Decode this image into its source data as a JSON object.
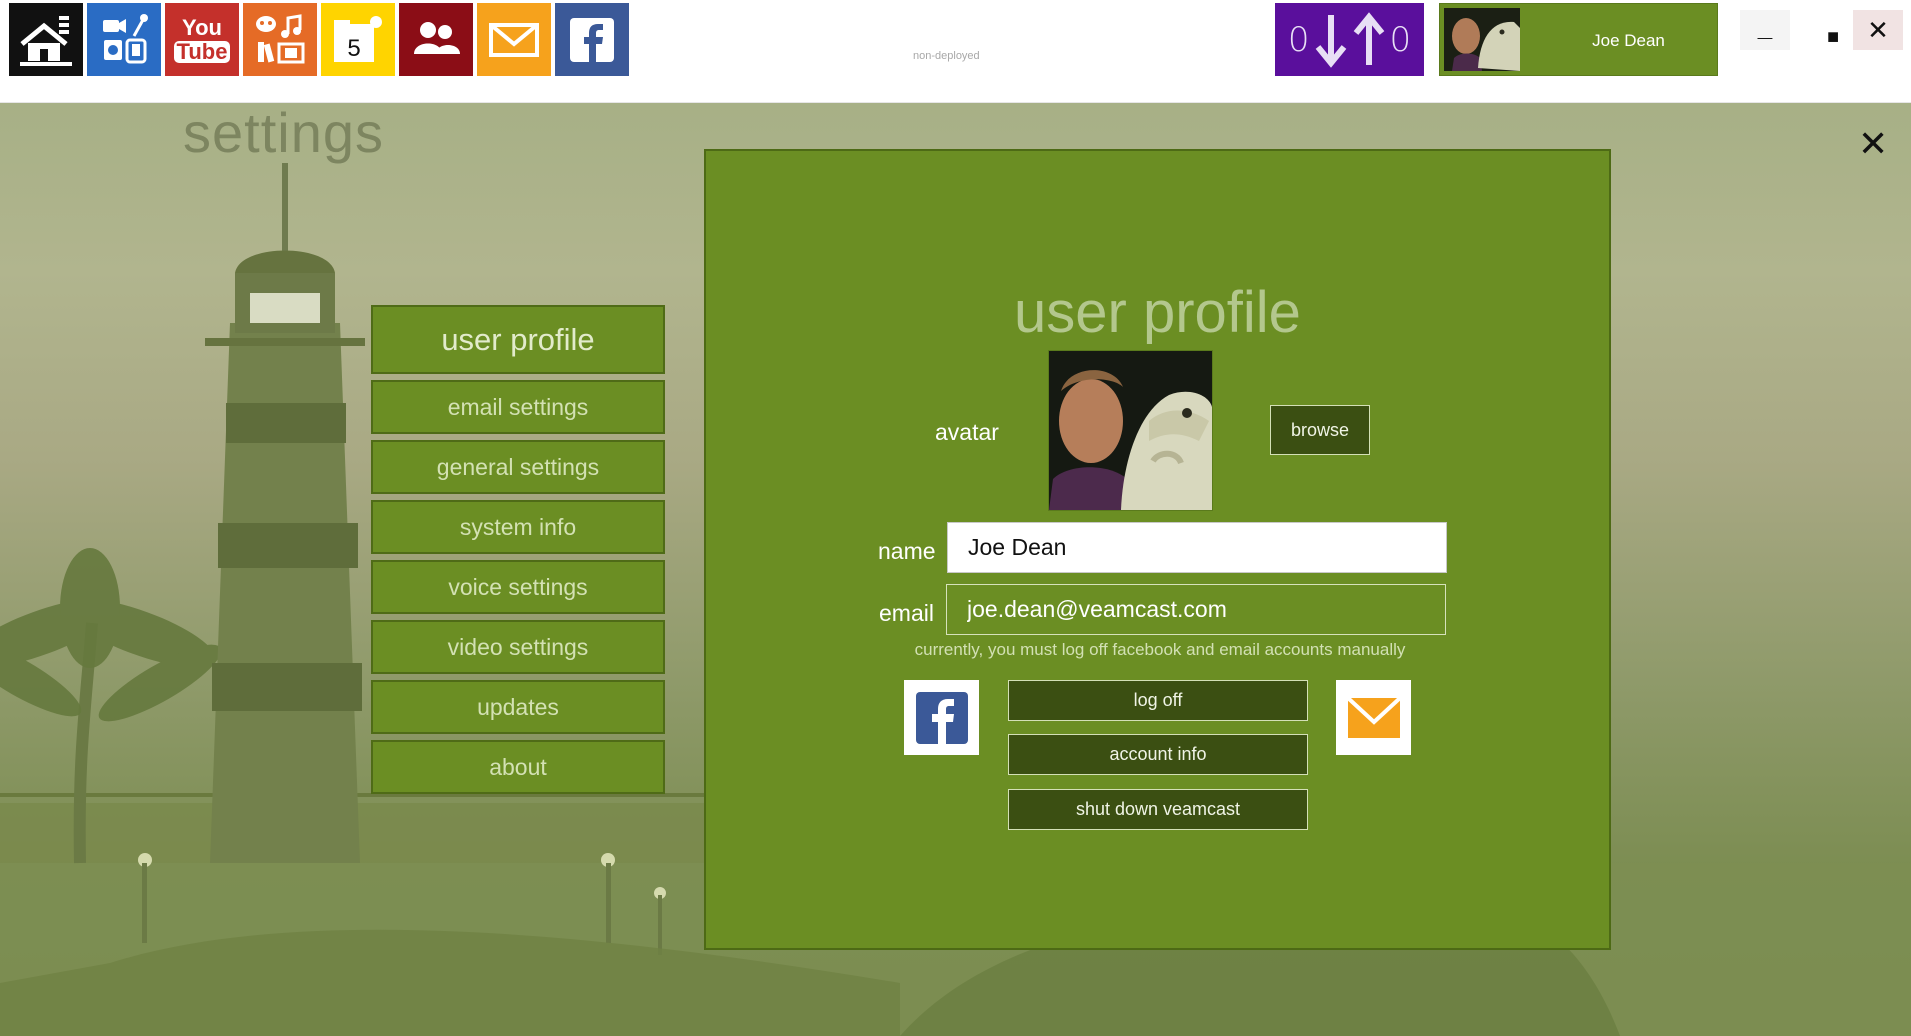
{
  "topbar": {
    "tiles": [
      {
        "icon": "home-icon",
        "color": "#111111"
      },
      {
        "icon": "media-devices-icon",
        "color": "#2a6cc4"
      },
      {
        "icon": "youtube-icon",
        "color": "#c4302b",
        "text_line1": "You",
        "text_line2": "Tube"
      },
      {
        "icon": "entertainment-icon",
        "color": "#e56b26"
      },
      {
        "icon": "calendar-icon",
        "color": "#ffd400",
        "day": "5"
      },
      {
        "icon": "contacts-icon",
        "color": "#8b0d16"
      },
      {
        "icon": "mail-icon",
        "color": "#f6a21c"
      },
      {
        "icon": "facebook-icon",
        "color": "#3b5998"
      }
    ],
    "deploy_label": "non-deployed",
    "transfer": {
      "down_count": "0",
      "up_count": "0",
      "color": "#5a0f9c"
    },
    "user_name": "Joe Dean",
    "window_controls": {
      "minimize": "_",
      "maximize": "■",
      "close": "✕"
    }
  },
  "page": {
    "title": "settings",
    "close_glyph": "✕"
  },
  "menu": {
    "items": [
      {
        "label": "user profile",
        "active": true
      },
      {
        "label": "email settings",
        "active": false
      },
      {
        "label": "general settings",
        "active": false
      },
      {
        "label": "system info",
        "active": false
      },
      {
        "label": "voice settings",
        "active": false
      },
      {
        "label": "video settings",
        "active": false
      },
      {
        "label": "updates",
        "active": false
      },
      {
        "label": "about",
        "active": false
      }
    ]
  },
  "profile": {
    "title": "user profile",
    "avatar_label": "avatar",
    "browse_label": "browse",
    "name_label": "name",
    "name_value": "Joe Dean",
    "email_label": "email",
    "email_value": "joe.dean@veamcast.com",
    "note": "currently, you must log off facebook and email accounts manually",
    "buttons": {
      "log_off": "log off",
      "account_info": "account info",
      "shut_down": "shut down veamcast"
    },
    "accent_color": "#6b8e23"
  }
}
